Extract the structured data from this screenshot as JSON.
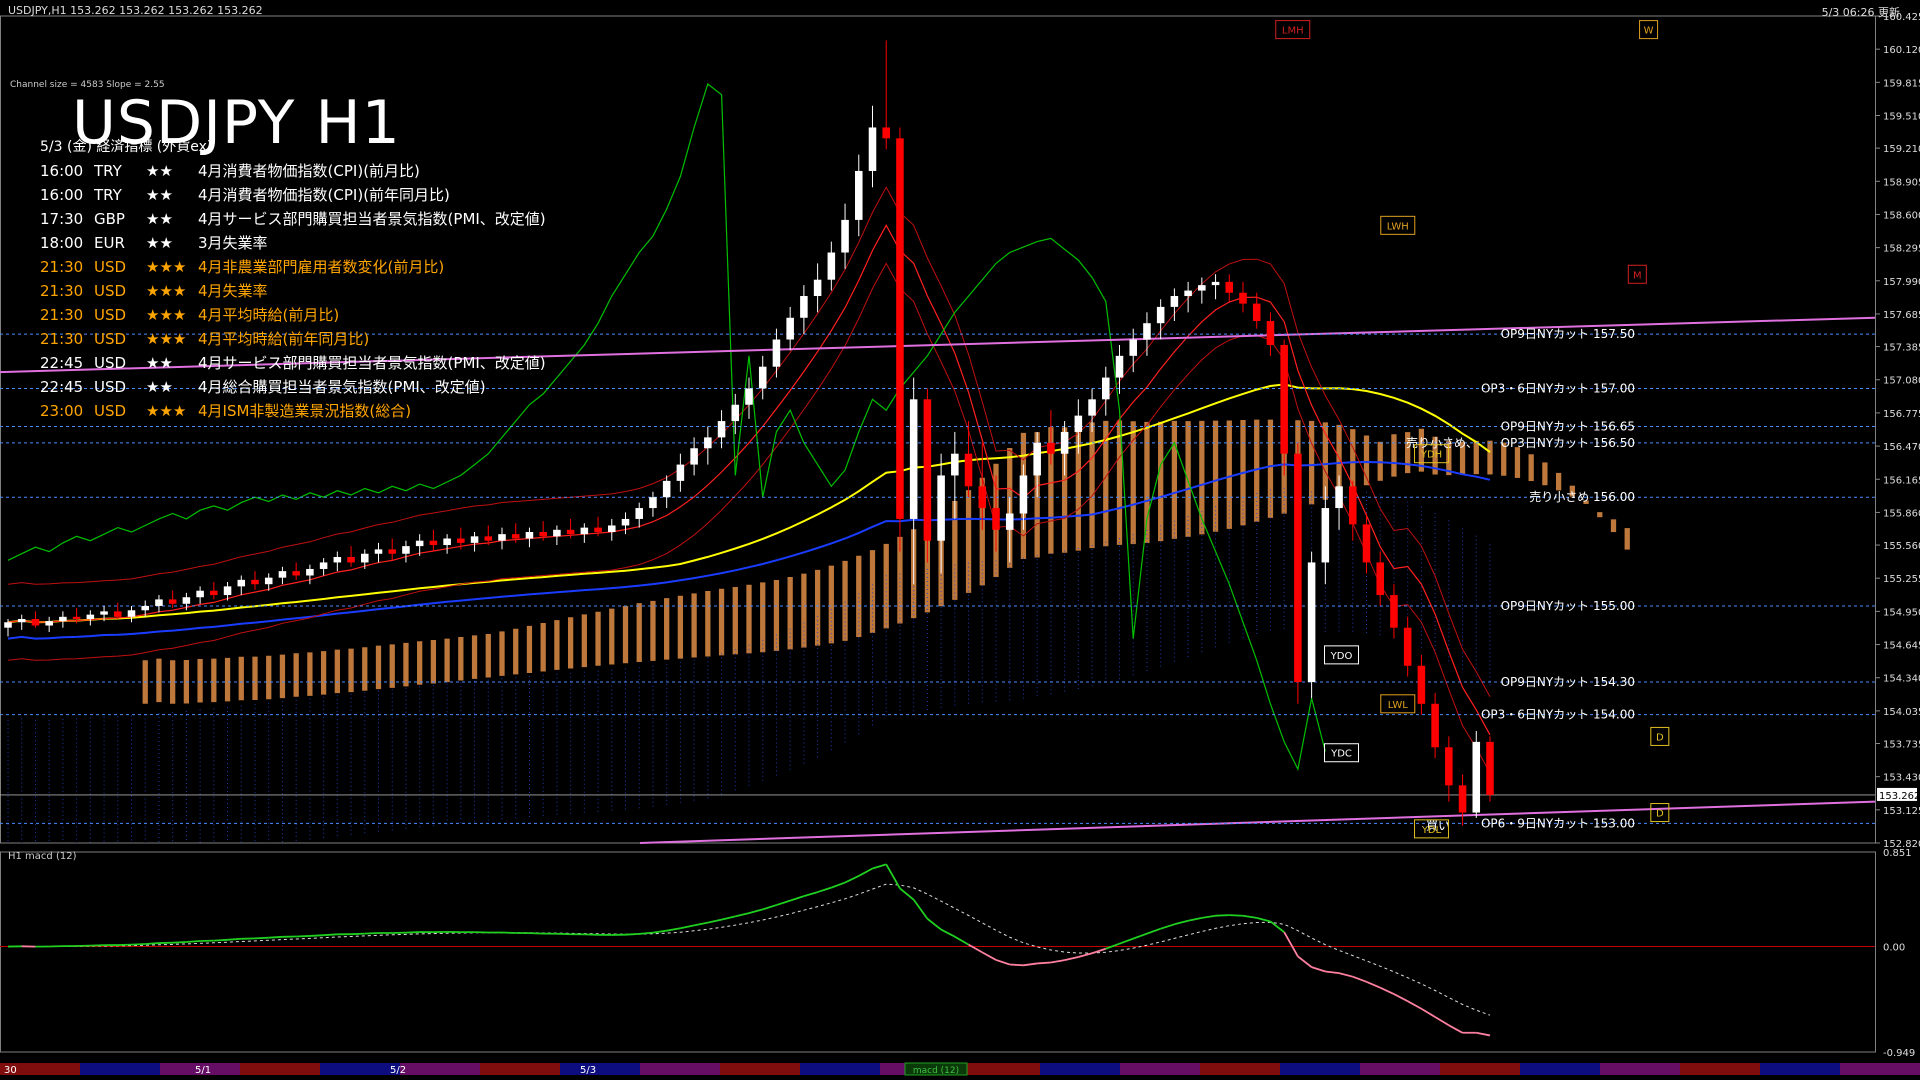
{
  "header": {
    "symbol_info": "USDJPY,H1  153.262 153.262 153.262 153.262",
    "updated": "5/3 06:26 更新"
  },
  "channel_info": "Channel size = 4583 Slope = 2.55",
  "title": "USDJPY H1",
  "calendar": {
    "header": "5/3 (金) 経済指標 (外貨ex)",
    "rows": [
      {
        "time": "16:00",
        "currency": "TRY",
        "importance": "★★",
        "event": "4月消費者物価指数(CPI)(前月比)",
        "color": "#ffffff"
      },
      {
        "time": "16:00",
        "currency": "TRY",
        "importance": "★★",
        "event": "4月消費者物価指数(CPI)(前年同月比)",
        "color": "#ffffff"
      },
      {
        "time": "17:30",
        "currency": "GBP",
        "importance": "★★",
        "event": "4月サービス部門購買担当者景気指数(PMI、改定値)",
        "color": "#ffffff"
      },
      {
        "time": "18:00",
        "currency": "EUR",
        "importance": "★★",
        "event": "3月失業率",
        "color": "#ffffff"
      },
      {
        "time": "21:30",
        "currency": "USD",
        "importance": "★★★",
        "event": "4月非農業部門雇用者数変化(前月比)",
        "color": "#ffa500"
      },
      {
        "time": "21:30",
        "currency": "USD",
        "importance": "★★★",
        "event": "4月失業率",
        "color": "#ffa500"
      },
      {
        "time": "21:30",
        "currency": "USD",
        "importance": "★★★",
        "event": "4月平均時給(前月比)",
        "color": "#ffa500"
      },
      {
        "time": "21:30",
        "currency": "USD",
        "importance": "★★★",
        "event": "4月平均時給(前年同月比)",
        "color": "#ffa500"
      },
      {
        "time": "22:45",
        "currency": "USD",
        "importance": "★★",
        "event": "4月サービス部門購買担当者景気指数(PMI、改定値)",
        "color": "#ffffff"
      },
      {
        "time": "22:45",
        "currency": "USD",
        "importance": "★★",
        "event": "4月総合購買担当者景気指数(PMI、改定値)",
        "color": "#ffffff"
      },
      {
        "time": "23:00",
        "currency": "USD",
        "importance": "★★★",
        "event": "4月ISM非製造業景況指数(総合)",
        "color": "#ffa500"
      }
    ]
  },
  "macd_label": "H1  macd (12)",
  "chart_data": {
    "type": "candlestick",
    "timeframe": "H1",
    "ylim": [
      152.82,
      160.425
    ],
    "y_ticks": [
      "160.425",
      "160.120",
      "159.815",
      "159.510",
      "159.210",
      "158.905",
      "158.600",
      "158.295",
      "157.990",
      "157.685",
      "157.385",
      "157.080",
      "156.775",
      "156.470",
      "156.165",
      "155.860",
      "155.560",
      "155.255",
      "154.950",
      "154.645",
      "154.340",
      "154.035",
      "153.735",
      "153.430",
      "153.125",
      "152.820"
    ],
    "current_price": "153.262",
    "colors": {
      "up": "#ffffff",
      "down": "#ff0000",
      "ma_yellow": "#ffff00",
      "ma_blue": "#1a3cff",
      "channel_pink": "#e070e0",
      "green_line": "#00c000",
      "ichimoku_cloud": "#ffa050"
    },
    "candles": [
      {
        "o": 154.8,
        "h": 154.88,
        "l": 154.72,
        "c": 154.85
      },
      {
        "o": 154.85,
        "h": 154.92,
        "l": 154.78,
        "c": 154.88
      },
      {
        "o": 154.88,
        "h": 154.95,
        "l": 154.8,
        "c": 154.82
      },
      {
        "o": 154.82,
        "h": 154.9,
        "l": 154.76,
        "c": 154.86
      },
      {
        "o": 154.86,
        "h": 154.95,
        "l": 154.8,
        "c": 154.9
      },
      {
        "o": 154.9,
        "h": 154.98,
        "l": 154.84,
        "c": 154.88
      },
      {
        "o": 154.88,
        "h": 154.96,
        "l": 154.82,
        "c": 154.92
      },
      {
        "o": 154.92,
        "h": 155.0,
        "l": 154.86,
        "c": 154.95
      },
      {
        "o": 154.95,
        "h": 155.03,
        "l": 154.88,
        "c": 154.9
      },
      {
        "o": 154.9,
        "h": 155.0,
        "l": 154.85,
        "c": 154.96
      },
      {
        "o": 154.96,
        "h": 155.05,
        "l": 154.9,
        "c": 155.0
      },
      {
        "o": 155.0,
        "h": 155.1,
        "l": 154.94,
        "c": 155.06
      },
      {
        "o": 155.06,
        "h": 155.14,
        "l": 154.98,
        "c": 155.02
      },
      {
        "o": 155.02,
        "h": 155.12,
        "l": 154.96,
        "c": 155.08
      },
      {
        "o": 155.08,
        "h": 155.18,
        "l": 155.02,
        "c": 155.14
      },
      {
        "o": 155.14,
        "h": 155.22,
        "l": 155.06,
        "c": 155.1
      },
      {
        "o": 155.1,
        "h": 155.22,
        "l": 155.05,
        "c": 155.18
      },
      {
        "o": 155.18,
        "h": 155.28,
        "l": 155.1,
        "c": 155.24
      },
      {
        "o": 155.24,
        "h": 155.32,
        "l": 155.15,
        "c": 155.2
      },
      {
        "o": 155.2,
        "h": 155.3,
        "l": 155.14,
        "c": 155.26
      },
      {
        "o": 155.26,
        "h": 155.36,
        "l": 155.2,
        "c": 155.32
      },
      {
        "o": 155.32,
        "h": 155.4,
        "l": 155.24,
        "c": 155.28
      },
      {
        "o": 155.28,
        "h": 155.38,
        "l": 155.2,
        "c": 155.34
      },
      {
        "o": 155.34,
        "h": 155.44,
        "l": 155.28,
        "c": 155.4
      },
      {
        "o": 155.4,
        "h": 155.5,
        "l": 155.32,
        "c": 155.45
      },
      {
        "o": 155.45,
        "h": 155.55,
        "l": 155.36,
        "c": 155.4
      },
      {
        "o": 155.4,
        "h": 155.52,
        "l": 155.34,
        "c": 155.48
      },
      {
        "o": 155.48,
        "h": 155.58,
        "l": 155.4,
        "c": 155.52
      },
      {
        "o": 155.52,
        "h": 155.62,
        "l": 155.42,
        "c": 155.48
      },
      {
        "o": 155.48,
        "h": 155.6,
        "l": 155.4,
        "c": 155.55
      },
      {
        "o": 155.55,
        "h": 155.66,
        "l": 155.46,
        "c": 155.6
      },
      {
        "o": 155.6,
        "h": 155.7,
        "l": 155.5,
        "c": 155.56
      },
      {
        "o": 155.56,
        "h": 155.66,
        "l": 155.48,
        "c": 155.62
      },
      {
        "o": 155.62,
        "h": 155.72,
        "l": 155.52,
        "c": 155.58
      },
      {
        "o": 155.58,
        "h": 155.68,
        "l": 155.5,
        "c": 155.64
      },
      {
        "o": 155.64,
        "h": 155.74,
        "l": 155.56,
        "c": 155.6
      },
      {
        "o": 155.6,
        "h": 155.72,
        "l": 155.52,
        "c": 155.66
      },
      {
        "o": 155.66,
        "h": 155.76,
        "l": 155.58,
        "c": 155.62
      },
      {
        "o": 155.62,
        "h": 155.72,
        "l": 155.54,
        "c": 155.68
      },
      {
        "o": 155.68,
        "h": 155.78,
        "l": 155.6,
        "c": 155.64
      },
      {
        "o": 155.64,
        "h": 155.74,
        "l": 155.56,
        "c": 155.7
      },
      {
        "o": 155.7,
        "h": 155.8,
        "l": 155.62,
        "c": 155.66
      },
      {
        "o": 155.66,
        "h": 155.76,
        "l": 155.58,
        "c": 155.72
      },
      {
        "o": 155.72,
        "h": 155.82,
        "l": 155.64,
        "c": 155.68
      },
      {
        "o": 155.68,
        "h": 155.8,
        "l": 155.6,
        "c": 155.74
      },
      {
        "o": 155.74,
        "h": 155.86,
        "l": 155.66,
        "c": 155.8
      },
      {
        "o": 155.8,
        "h": 155.95,
        "l": 155.72,
        "c": 155.9
      },
      {
        "o": 155.9,
        "h": 156.05,
        "l": 155.82,
        "c": 156.0
      },
      {
        "o": 156.0,
        "h": 156.2,
        "l": 155.9,
        "c": 156.15
      },
      {
        "o": 156.15,
        "h": 156.4,
        "l": 156.05,
        "c": 156.3
      },
      {
        "o": 156.3,
        "h": 156.55,
        "l": 156.2,
        "c": 156.45
      },
      {
        "o": 156.45,
        "h": 156.65,
        "l": 156.3,
        "c": 156.55
      },
      {
        "o": 156.55,
        "h": 156.8,
        "l": 156.45,
        "c": 156.7
      },
      {
        "o": 156.7,
        "h": 156.95,
        "l": 156.58,
        "c": 156.85
      },
      {
        "o": 156.85,
        "h": 157.1,
        "l": 156.72,
        "c": 157.0
      },
      {
        "o": 157.0,
        "h": 157.3,
        "l": 156.9,
        "c": 157.2
      },
      {
        "o": 157.2,
        "h": 157.55,
        "l": 157.1,
        "c": 157.45
      },
      {
        "o": 157.45,
        "h": 157.75,
        "l": 157.35,
        "c": 157.65
      },
      {
        "o": 157.65,
        "h": 157.95,
        "l": 157.5,
        "c": 157.85
      },
      {
        "o": 157.85,
        "h": 158.15,
        "l": 157.7,
        "c": 158.0
      },
      {
        "o": 158.0,
        "h": 158.35,
        "l": 157.9,
        "c": 158.25
      },
      {
        "o": 158.25,
        "h": 158.7,
        "l": 158.1,
        "c": 158.55
      },
      {
        "o": 158.55,
        "h": 159.15,
        "l": 158.4,
        "c": 159.0
      },
      {
        "o": 159.0,
        "h": 159.6,
        "l": 158.85,
        "c": 159.4
      },
      {
        "o": 159.4,
        "h": 160.2,
        "l": 159.2,
        "c": 159.3
      },
      {
        "o": 159.3,
        "h": 159.4,
        "l": 155.5,
        "c": 155.8
      },
      {
        "o": 155.8,
        "h": 157.1,
        "l": 155.2,
        "c": 156.9
      },
      {
        "o": 156.9,
        "h": 157.0,
        "l": 155.4,
        "c": 155.6
      },
      {
        "o": 155.6,
        "h": 156.4,
        "l": 155.3,
        "c": 156.2
      },
      {
        "o": 156.2,
        "h": 156.6,
        "l": 155.8,
        "c": 156.4
      },
      {
        "o": 156.4,
        "h": 156.7,
        "l": 156.0,
        "c": 156.1
      },
      {
        "o": 156.1,
        "h": 156.5,
        "l": 155.7,
        "c": 155.9
      },
      {
        "o": 155.9,
        "h": 156.2,
        "l": 155.5,
        "c": 155.7
      },
      {
        "o": 155.7,
        "h": 156.0,
        "l": 155.4,
        "c": 155.85
      },
      {
        "o": 155.85,
        "h": 156.3,
        "l": 155.7,
        "c": 156.2
      },
      {
        "o": 156.2,
        "h": 156.6,
        "l": 156.0,
        "c": 156.5
      },
      {
        "o": 156.5,
        "h": 156.8,
        "l": 156.3,
        "c": 156.4
      },
      {
        "o": 156.4,
        "h": 156.7,
        "l": 156.2,
        "c": 156.6
      },
      {
        "o": 156.6,
        "h": 156.9,
        "l": 156.4,
        "c": 156.75
      },
      {
        "o": 156.75,
        "h": 157.0,
        "l": 156.6,
        "c": 156.9
      },
      {
        "o": 156.9,
        "h": 157.2,
        "l": 156.75,
        "c": 157.1
      },
      {
        "o": 157.1,
        "h": 157.4,
        "l": 156.95,
        "c": 157.3
      },
      {
        "o": 157.3,
        "h": 157.55,
        "l": 157.15,
        "c": 157.45
      },
      {
        "o": 157.45,
        "h": 157.7,
        "l": 157.3,
        "c": 157.6
      },
      {
        "o": 157.6,
        "h": 157.82,
        "l": 157.45,
        "c": 157.75
      },
      {
        "o": 157.75,
        "h": 157.92,
        "l": 157.62,
        "c": 157.85
      },
      {
        "o": 157.85,
        "h": 157.98,
        "l": 157.7,
        "c": 157.9
      },
      {
        "o": 157.9,
        "h": 158.02,
        "l": 157.78,
        "c": 157.95
      },
      {
        "o": 157.95,
        "h": 158.05,
        "l": 157.82,
        "c": 157.98
      },
      {
        "o": 157.98,
        "h": 158.05,
        "l": 157.8,
        "c": 157.88
      },
      {
        "o": 157.88,
        "h": 157.98,
        "l": 157.7,
        "c": 157.78
      },
      {
        "o": 157.78,
        "h": 157.88,
        "l": 157.55,
        "c": 157.62
      },
      {
        "o": 157.62,
        "h": 157.7,
        "l": 157.3,
        "c": 157.4
      },
      {
        "o": 157.4,
        "h": 157.45,
        "l": 156.2,
        "c": 156.4
      },
      {
        "o": 156.4,
        "h": 156.5,
        "l": 154.1,
        "c": 154.3
      },
      {
        "o": 154.3,
        "h": 155.5,
        "l": 154.15,
        "c": 155.4
      },
      {
        "o": 155.4,
        "h": 156.1,
        "l": 155.2,
        "c": 155.9
      },
      {
        "o": 155.9,
        "h": 156.2,
        "l": 155.7,
        "c": 156.1
      },
      {
        "o": 156.1,
        "h": 156.15,
        "l": 155.6,
        "c": 155.75
      },
      {
        "o": 155.75,
        "h": 155.85,
        "l": 155.3,
        "c": 155.4
      },
      {
        "o": 155.4,
        "h": 155.5,
        "l": 155.0,
        "c": 155.1
      },
      {
        "o": 155.1,
        "h": 155.2,
        "l": 154.7,
        "c": 154.8
      },
      {
        "o": 154.8,
        "h": 154.9,
        "l": 154.35,
        "c": 154.45
      },
      {
        "o": 154.45,
        "h": 154.55,
        "l": 154.0,
        "c": 154.1
      },
      {
        "o": 154.1,
        "h": 154.2,
        "l": 153.6,
        "c": 153.7
      },
      {
        "o": 153.7,
        "h": 153.8,
        "l": 153.2,
        "c": 153.35
      },
      {
        "o": 153.35,
        "h": 153.45,
        "l": 152.98,
        "c": 153.1
      },
      {
        "o": 153.1,
        "h": 153.85,
        "l": 153.05,
        "c": 153.75
      },
      {
        "o": 153.75,
        "h": 153.8,
        "l": 153.2,
        "c": 153.262
      }
    ],
    "horizontal_levels": [
      {
        "price": 157.5,
        "label": "OP9日NYカット 157.50",
        "color": "#4a8cff"
      },
      {
        "price": 157.0,
        "label": "OP3・6日NYカット 157.00",
        "color": "#4a8cff"
      },
      {
        "price": 156.65,
        "label": "OP9日NYカット 156.65",
        "color": "#4a8cff"
      },
      {
        "price": 156.5,
        "label": "OP3日NYカット 156.50",
        "color": "#4a8cff"
      },
      {
        "price": 156.0,
        "label": "売り小さめ 156.00",
        "color": "#4a8cff"
      },
      {
        "price": 155.0,
        "label": "OP9日NYカット 155.00",
        "color": "#4a8cff"
      },
      {
        "price": 154.3,
        "label": "OP9日NYカット 154.30",
        "color": "#4a8cff"
      },
      {
        "price": 154.0,
        "label": "OP3・6日NYカット 154.00",
        "color": "#4a8cff"
      },
      {
        "price": 153.0,
        "label": "OP6・9日NYカット 153.00",
        "color": "#4a8cff"
      }
    ],
    "extra_labels": [
      {
        "price": 156.5,
        "label": "売り小さめ、",
        "align": "left-of"
      },
      {
        "price": 152.98,
        "label": "買い",
        "align": "left-of"
      }
    ],
    "marker_boxes": [
      {
        "label": "LMH",
        "color": "#d02020"
      },
      {
        "label": "W",
        "color": "#e0a020"
      },
      {
        "label": "LWH",
        "color": "#e0a020"
      },
      {
        "label": "M",
        "color": "#d02020"
      },
      {
        "label": "YDH",
        "color": "#e0c020"
      },
      {
        "label": "YDO",
        "color": "#ffffff"
      },
      {
        "label": "LWL",
        "color": "#e0a020"
      },
      {
        "label": "YDC",
        "color": "#ffffff"
      },
      {
        "label": "YDL",
        "color": "#e0c020"
      },
      {
        "label": "D",
        "color": "#e0c020"
      },
      {
        "label": "D",
        "color": "#e0c020"
      }
    ],
    "macd": {
      "y_ticks": [
        "0.851",
        "0.00",
        "-0.949"
      ],
      "ylim": [
        -0.949,
        0.851
      ]
    },
    "x_ticks": [
      "30",
      "5/1",
      "5/2",
      "5/3"
    ],
    "bottom_tab": "macd (12)"
  }
}
